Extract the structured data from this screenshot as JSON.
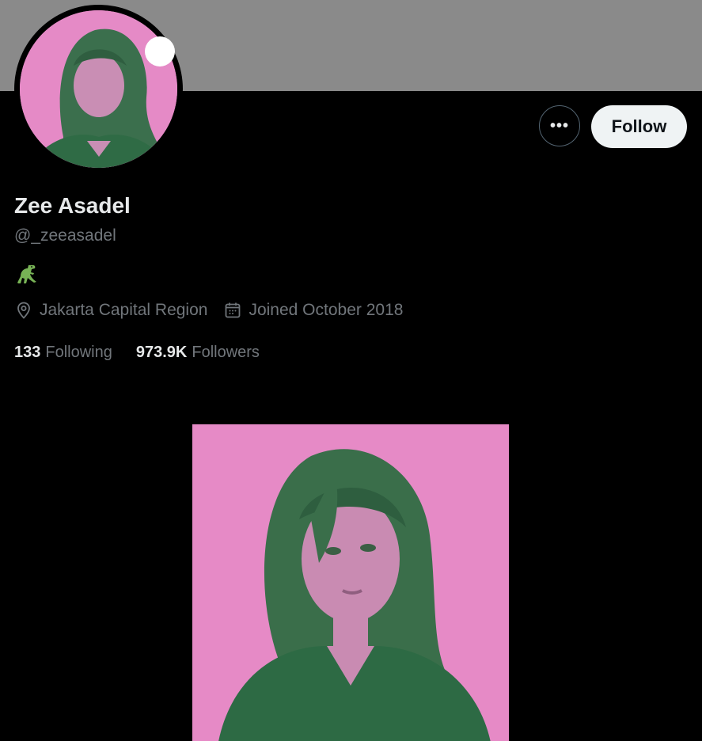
{
  "profile": {
    "display_name": "Zee Asadel",
    "handle": "@_zeeasadel",
    "bio_emoji_icon": "t-rex-icon",
    "location": "Jakarta Capital Region",
    "joined": "Joined October 2018"
  },
  "actions": {
    "more_label": "•••",
    "follow_label": "Follow"
  },
  "stats": {
    "following_count": "133",
    "following_label": "Following",
    "followers_count": "973.9K",
    "followers_label": "Followers"
  },
  "colors": {
    "background": "#000000",
    "banner": "#8a8a8a",
    "photo_pink": "#e68ac6",
    "photo_green": "#2e6e48",
    "muted_text": "#71767b"
  }
}
